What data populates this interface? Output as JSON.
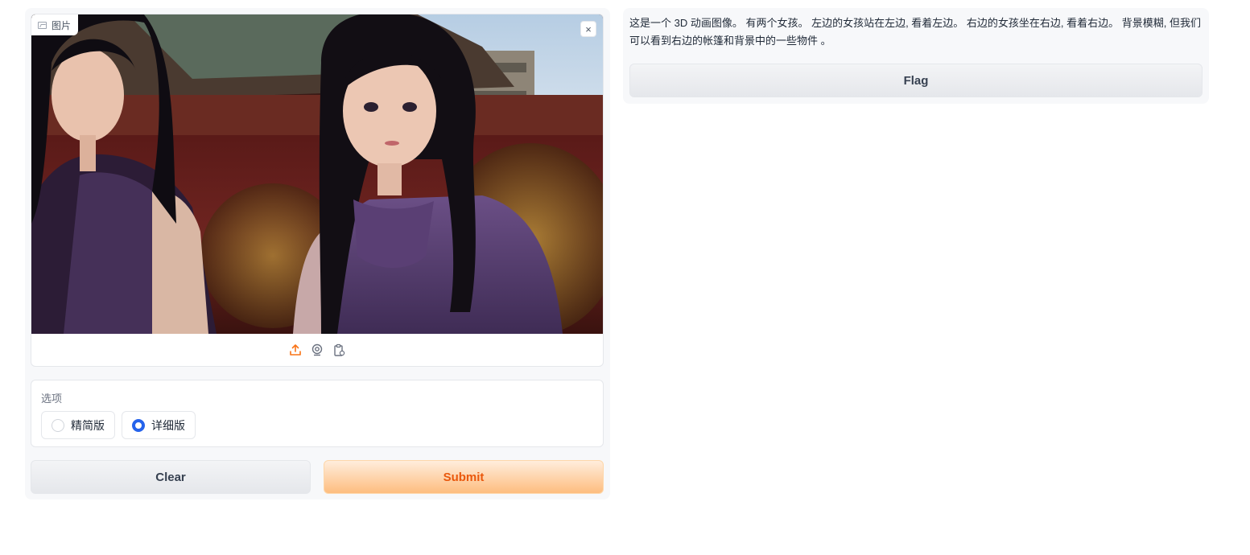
{
  "image_input": {
    "label": "图片",
    "label_icon": "image-icon",
    "close_symbol": "×",
    "close_icon": "close-icon",
    "source_icons": [
      "upload-icon",
      "webcam-icon",
      "clipboard-icon"
    ],
    "active_source_color": "#f97316"
  },
  "options": {
    "label": "选项",
    "choices": [
      {
        "label": "精简版",
        "selected": false
      },
      {
        "label": "详细版",
        "selected": true
      }
    ],
    "selected_color": "#2563eb"
  },
  "buttons": {
    "clear": "Clear",
    "submit": "Submit"
  },
  "output": {
    "text": "这是一个 3D 动画图像。 有两个女孩。 左边的女孩站在左边, 看着左边。 右边的女孩坐在右边, 看着右边。 背景模糊, 但我们可以看到右边的帐篷和背景中的一些物件 。",
    "flag_label": "Flag"
  },
  "colors": {
    "accent": "#f97316",
    "submit_text": "#ea580c",
    "panel_bg": "#f7f8fa"
  }
}
